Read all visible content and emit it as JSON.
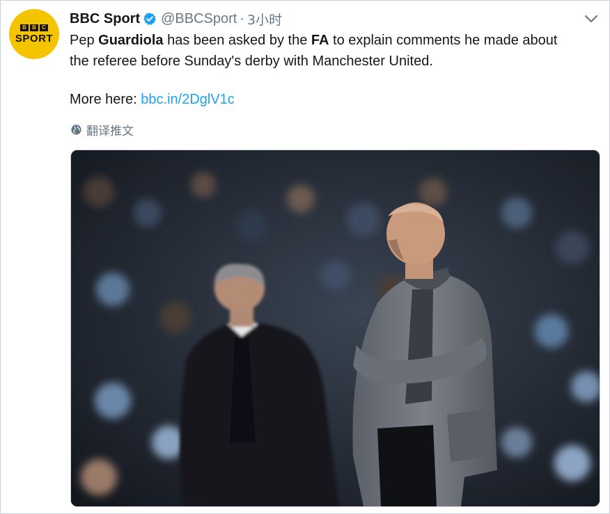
{
  "author": {
    "avatar_text_top": "BBC",
    "avatar_text_bottom": "SPORT",
    "name": "BBC Sport",
    "handle": "@BBCSport",
    "separator": "·",
    "time": "3小时"
  },
  "tweet": {
    "line1_part1": "Pep ",
    "line1_bold1": "Guardiola",
    "line1_part2": " has been asked by the ",
    "line1_bold2": "FA",
    "line1_part3": " to explain comments he made about",
    "line2": "the referee before Sunday's derby with Manchester United.",
    "more_label": "More here: ",
    "link_text": "bbc.in/2DglV1c"
  },
  "translate": {
    "label": "翻译推文"
  },
  "icons": {
    "verified": "verified-badge-icon",
    "caret": "chevron-down-icon",
    "globe": "globe-icon"
  },
  "colors": {
    "avatar": "#f5c400",
    "link": "#1da1f2",
    "muted": "#657786",
    "text": "#14171a"
  }
}
